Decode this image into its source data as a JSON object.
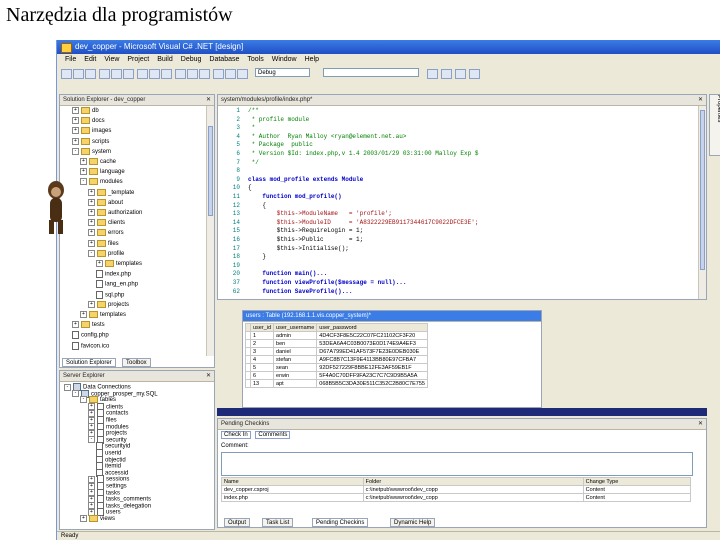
{
  "slide_title": "Narzędzia dla programistów",
  "window_title": "dev_copper - Microsoft Visual C# .NET [design]",
  "menu": [
    "File",
    "Edit",
    "View",
    "Project",
    "Build",
    "Debug",
    "Database",
    "Tools",
    "Window",
    "Help"
  ],
  "toolbar": {
    "config_value": "Debug"
  },
  "solution_explorer": {
    "title": "Solution Explorer - dev_copper",
    "items": [
      {
        "label": "db",
        "indent": 1,
        "kind": "folder",
        "exp": "+"
      },
      {
        "label": "docs",
        "indent": 1,
        "kind": "folder",
        "exp": "+"
      },
      {
        "label": "images",
        "indent": 1,
        "kind": "folder",
        "exp": "+"
      },
      {
        "label": "scripts",
        "indent": 1,
        "kind": "folder",
        "exp": "+"
      },
      {
        "label": "system",
        "indent": 1,
        "kind": "folder",
        "exp": "-"
      },
      {
        "label": "cache",
        "indent": 2,
        "kind": "folder",
        "exp": "+"
      },
      {
        "label": "language",
        "indent": 2,
        "kind": "folder",
        "exp": "+"
      },
      {
        "label": "modules",
        "indent": 2,
        "kind": "folder",
        "exp": "-"
      },
      {
        "label": "_template",
        "indent": 3,
        "kind": "folder",
        "exp": "+"
      },
      {
        "label": "about",
        "indent": 3,
        "kind": "folder",
        "exp": "+"
      },
      {
        "label": "authorization",
        "indent": 3,
        "kind": "folder",
        "exp": "+"
      },
      {
        "label": "clients",
        "indent": 3,
        "kind": "folder",
        "exp": "+"
      },
      {
        "label": "errors",
        "indent": 3,
        "kind": "folder",
        "exp": "+"
      },
      {
        "label": "files",
        "indent": 3,
        "kind": "folder",
        "exp": "+"
      },
      {
        "label": "profile",
        "indent": 3,
        "kind": "folder",
        "exp": "-"
      },
      {
        "label": "templates",
        "indent": 4,
        "kind": "folder",
        "exp": "+"
      },
      {
        "label": "index.php",
        "indent": 4,
        "kind": "file",
        "exp": ""
      },
      {
        "label": "lang_en.php",
        "indent": 4,
        "kind": "file",
        "exp": ""
      },
      {
        "label": "sql.php",
        "indent": 4,
        "kind": "file",
        "exp": ""
      },
      {
        "label": "projects",
        "indent": 3,
        "kind": "folder",
        "exp": "+"
      },
      {
        "label": "templates",
        "indent": 2,
        "kind": "folder",
        "exp": "+"
      },
      {
        "label": "tests",
        "indent": 1,
        "kind": "folder",
        "exp": "+"
      },
      {
        "label": "config.php",
        "indent": 1,
        "kind": "file",
        "exp": ""
      },
      {
        "label": "favicon.ico",
        "indent": 1,
        "kind": "file",
        "exp": ""
      }
    ],
    "tabs": [
      "Solution Explorer",
      "Toolbox"
    ]
  },
  "server_explorer": {
    "title": "Server Explorer",
    "items": [
      {
        "label": "Data Connections",
        "indent": 0,
        "kind": "db",
        "exp": "-"
      },
      {
        "label": "copper_prosper_my.SQL",
        "indent": 1,
        "kind": "db",
        "exp": "-"
      },
      {
        "label": "tables",
        "indent": 2,
        "kind": "folder",
        "exp": "-"
      },
      {
        "label": "clients",
        "indent": 3,
        "kind": "file",
        "exp": "+"
      },
      {
        "label": "contacts",
        "indent": 3,
        "kind": "file",
        "exp": "+"
      },
      {
        "label": "files",
        "indent": 3,
        "kind": "file",
        "exp": "+"
      },
      {
        "label": "modules",
        "indent": 3,
        "kind": "file",
        "exp": "+"
      },
      {
        "label": "projects",
        "indent": 3,
        "kind": "file",
        "exp": "+"
      },
      {
        "label": "security",
        "indent": 3,
        "kind": "file",
        "exp": "-"
      },
      {
        "label": "securityid",
        "indent": 4,
        "kind": "file",
        "exp": ""
      },
      {
        "label": "userid",
        "indent": 4,
        "kind": "file",
        "exp": ""
      },
      {
        "label": "objectid",
        "indent": 4,
        "kind": "file",
        "exp": ""
      },
      {
        "label": "itemid",
        "indent": 4,
        "kind": "file",
        "exp": ""
      },
      {
        "label": "accessid",
        "indent": 4,
        "kind": "file",
        "exp": ""
      },
      {
        "label": "sessions",
        "indent": 3,
        "kind": "file",
        "exp": "+"
      },
      {
        "label": "settings",
        "indent": 3,
        "kind": "file",
        "exp": "+"
      },
      {
        "label": "tasks",
        "indent": 3,
        "kind": "file",
        "exp": "+"
      },
      {
        "label": "tasks_comments",
        "indent": 3,
        "kind": "file",
        "exp": "+"
      },
      {
        "label": "tasks_delegation",
        "indent": 3,
        "kind": "file",
        "exp": "+"
      },
      {
        "label": "users",
        "indent": 3,
        "kind": "file",
        "exp": "+"
      },
      {
        "label": "views",
        "indent": 2,
        "kind": "folder",
        "exp": "+"
      }
    ]
  },
  "editor": {
    "tab": "system/modules/profile/index.php*",
    "lines": [
      {
        "n": "1",
        "t": "/**",
        "c": "cmt"
      },
      {
        "n": "2",
        "t": " * profile module",
        "c": "cmt"
      },
      {
        "n": "3",
        "t": " *",
        "c": "cmt"
      },
      {
        "n": "4",
        "t": " * Author  Ryan Malloy <ryan@element.net.au>",
        "c": "cmt"
      },
      {
        "n": "5",
        "t": " * Package  public",
        "c": "cmt"
      },
      {
        "n": "6",
        "t": " * Version $Id: index.php,v 1.4 2003/01/29 03:31:00 Malloy Exp $",
        "c": "cmt"
      },
      {
        "n": "7",
        "t": " */",
        "c": "cmt"
      },
      {
        "n": "8",
        "t": "",
        "c": ""
      },
      {
        "n": "9",
        "t": "class mod_profile extends Module",
        "c": "kw"
      },
      {
        "n": "10",
        "t": "{",
        "c": ""
      },
      {
        "n": "11",
        "t": "    function mod_profile()",
        "c": "kw"
      },
      {
        "n": "12",
        "t": "    {",
        "c": ""
      },
      {
        "n": "13",
        "t": "        $this->ModuleName   = 'profile';",
        "c": "str"
      },
      {
        "n": "14",
        "t": "        $this->ModuleID     = 'A8322229EB9117344617C9022DFCE3E';",
        "c": "str"
      },
      {
        "n": "15",
        "t": "        $this->RequireLogin = 1;",
        "c": ""
      },
      {
        "n": "16",
        "t": "        $this->Public       = 1;",
        "c": ""
      },
      {
        "n": "17",
        "t": "        $this->Initialise();",
        "c": ""
      },
      {
        "n": "18",
        "t": "    }",
        "c": ""
      },
      {
        "n": "19",
        "t": "",
        "c": ""
      },
      {
        "n": "20",
        "t": "    function main()...",
        "c": "kw"
      },
      {
        "n": "37",
        "t": "    function viewProfile($message = null)...",
        "c": "kw"
      },
      {
        "n": "62",
        "t": "    function SaveProfile()...",
        "c": "kw"
      }
    ]
  },
  "table_view": {
    "title": "users : Table (192.168.1.1.vis.copper_system)*",
    "columns": [
      "user_id",
      "user_username",
      "user_password"
    ],
    "rows": [
      [
        "1",
        "admin",
        "4D4CF3F8E5C22C07FC21102CF3F20"
      ],
      [
        "2",
        "ben",
        "53DEA6A4C03B0073E0D174E9A4EF3"
      ],
      [
        "3",
        "daniel",
        "D67A799ED41AF573F7E23E0DEB030E"
      ],
      [
        "4",
        "stefan",
        "A9FC8B7C13F9E4113BB80E97CFBA7"
      ],
      [
        "5",
        "sean",
        "92DF527229F8BBE12FE3AF59EB1F"
      ],
      [
        "6",
        "erwin",
        "5F4A0C70DFF9FA23C7C7C9D9B5A5A"
      ],
      [
        "13",
        "apt",
        "068B5B5C3DA30E511C352C2B80C7E755"
      ]
    ]
  },
  "pending_checkins": {
    "title": "Pending Checkins",
    "toolbar": [
      "Check In",
      "Comments"
    ],
    "comment_label": "Comment:",
    "columns": [
      "Name",
      "Folder",
      "Change Type"
    ],
    "rows": [
      [
        "dev_copper.csproj",
        "c:\\inetpub\\wwwroot\\dev_copp",
        "Content"
      ],
      [
        "index.php",
        "c:\\inetpub\\wwwroot\\dev_copp",
        "Content"
      ]
    ]
  },
  "bottom_tabs": [
    "Output",
    "Task List",
    "Pending Checkins",
    "Dynamic Help"
  ],
  "status": "Ready"
}
